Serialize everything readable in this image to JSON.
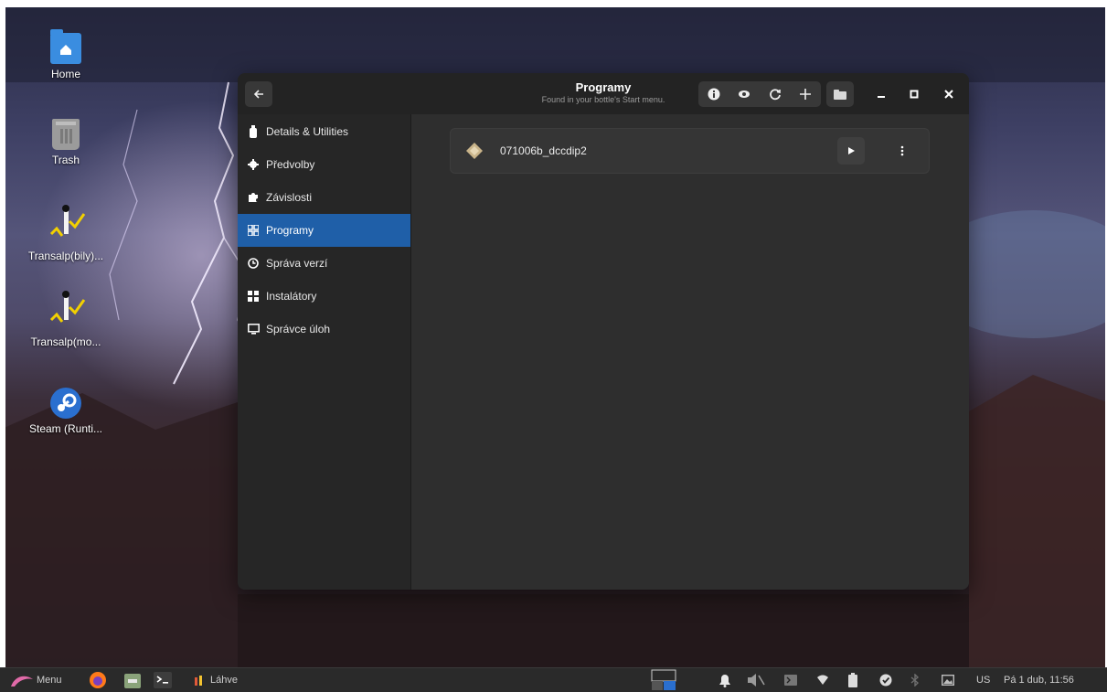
{
  "desktop": {
    "icons": [
      {
        "label": "Home"
      },
      {
        "label": "Trash"
      },
      {
        "label": "Transalp(bily)..."
      },
      {
        "label": "Transalp(mo..."
      },
      {
        "label": "Steam (Runti..."
      }
    ]
  },
  "window": {
    "title": "Programy",
    "subtitle": "Found in your bottle's Start menu.",
    "sidebar": [
      {
        "label": "Details & Utilities",
        "icon": "bottle-icon"
      },
      {
        "label": "Předvolby",
        "icon": "gear-icon"
      },
      {
        "label": "Závislosti",
        "icon": "puzzle-icon"
      },
      {
        "label": "Programy",
        "icon": "apps-grid-icon",
        "active": true
      },
      {
        "label": "Správa verzí",
        "icon": "clock-icon"
      },
      {
        "label": "Instalátory",
        "icon": "installers-icon"
      },
      {
        "label": "Správce úloh",
        "icon": "monitor-icon"
      }
    ],
    "programs": [
      {
        "name": "071006b_dccdip2"
      }
    ]
  },
  "taskbar": {
    "menu_label": "Menu",
    "window_label": "Láhve",
    "keyboard_layout": "US",
    "datetime": "Pá 1 dub, 11:56"
  },
  "colors": {
    "accent": "#1f5fa8",
    "window_bg": "#2d2d2d",
    "header_bg": "#232323"
  }
}
